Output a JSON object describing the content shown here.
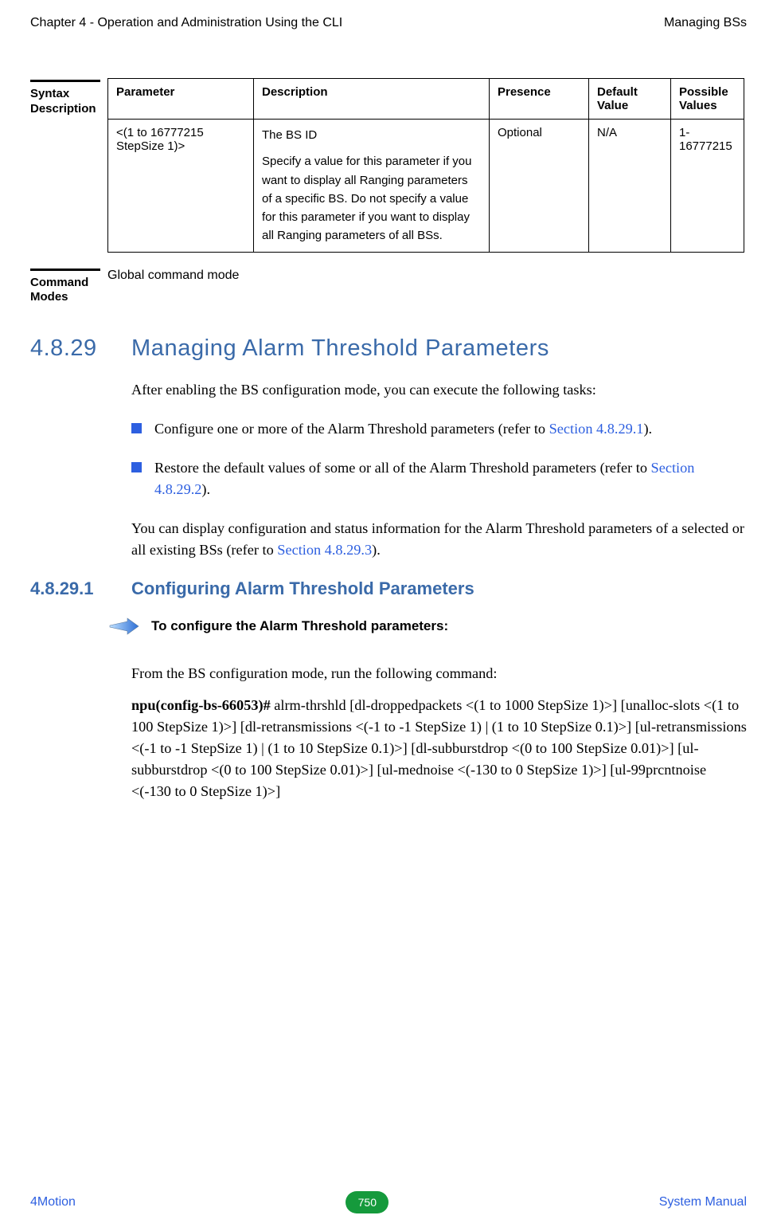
{
  "header": {
    "left": "Chapter 4 - Operation and Administration Using the CLI",
    "right": "Managing BSs"
  },
  "syntax": {
    "label_l1": "Syntax",
    "label_l2": "Description",
    "cols": {
      "parameter": "Parameter",
      "description": "Description",
      "presence": "Presence",
      "default": "Default Value",
      "possible": "Possible Values"
    },
    "row": {
      "parameter": "<(1 to 16777215 StepSize 1)>",
      "desc_l1": "The BS ID",
      "desc_l2": "Specify a value for this parameter if you want to display all Ranging parameters of a specific BS. Do not specify a value for this parameter if you want to display all Ranging parameters of all BSs.",
      "presence": "Optional",
      "default": "N/A",
      "possible": "1-16777215"
    }
  },
  "cmdmodes": {
    "label_l1": "Command",
    "label_l2": "Modes",
    "value": "Global command mode"
  },
  "sec29": {
    "num": "4.8.29",
    "title": "Managing Alarm Threshold Parameters",
    "intro": "After enabling the BS configuration mode, you can execute the following tasks:",
    "b1_a": "Configure one or more of the Alarm Threshold parameters (refer to ",
    "b1_link": "Section 4.8.29.1",
    "b1_c": ").",
    "b2_a": "Restore the default values of some or all of the Alarm Threshold parameters (refer to ",
    "b2_link": "Section 4.8.29.2",
    "b2_c": ").",
    "p2_a": "You can display configuration and status information for the Alarm Threshold parameters of a selected or all existing BSs (refer to ",
    "p2_link": "Section 4.8.29.3",
    "p2_c": ")."
  },
  "sec291": {
    "num": "4.8.29.1",
    "title": "Configuring Alarm Threshold Parameters",
    "to_configure": "To configure the Alarm Threshold parameters:",
    "run": "From the BS configuration mode, run the following command:",
    "cmd_bold": "npu(config-bs-66053)# ",
    "cmd_rest": "alrm-thrshld [dl-droppedpackets <(1 to 1000 StepSize 1)>] [unalloc-slots <(1 to 100 StepSize 1)>] [dl-retransmissions <(-1 to -1 StepSize 1) | (1 to 10 StepSize 0.1)>] [ul-retransmissions <(-1 to -1 StepSize 1) | (1 to 10 StepSize 0.1)>] [dl-subburstdrop <(0 to 100 StepSize 0.01)>] [ul-subburstdrop <(0 to 100 StepSize 0.01)>] [ul-mednoise <(-130 to 0 StepSize 1)>] [ul-99prcntnoise <(-130 to 0 StepSize 1)>]"
  },
  "footer": {
    "left": "4Motion",
    "page": "750",
    "right": "System Manual"
  }
}
